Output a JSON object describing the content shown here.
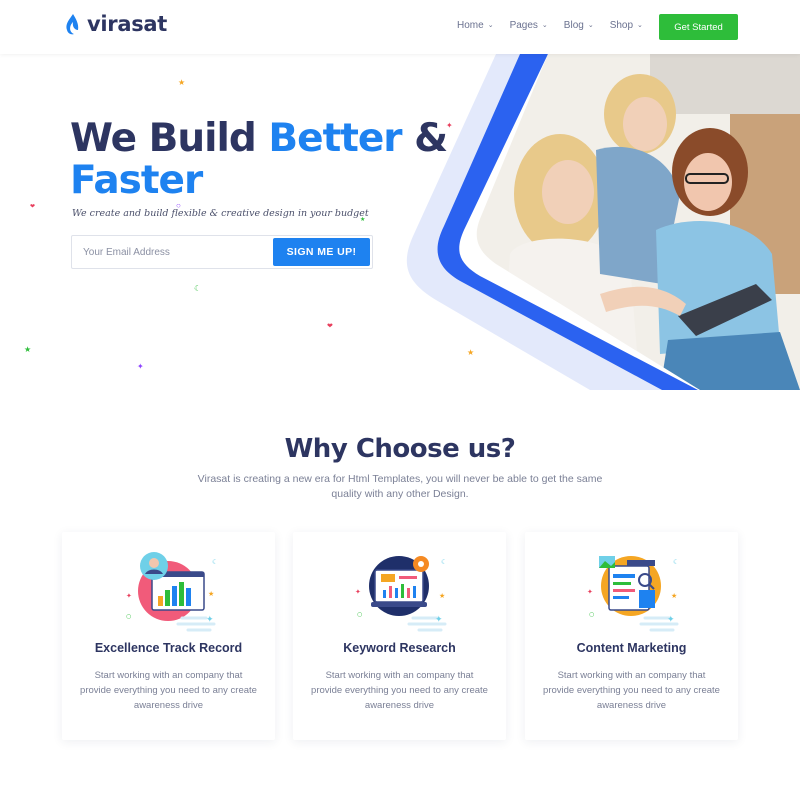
{
  "header": {
    "logo_text": "virasat",
    "nav": [
      {
        "label": "Home"
      },
      {
        "label": "Pages"
      },
      {
        "label": "Blog"
      },
      {
        "label": "Shop"
      }
    ],
    "cta_label": "Get Started"
  },
  "hero": {
    "headline_part1": "We Build ",
    "headline_highlight1": "Better",
    "headline_part2": " &",
    "headline_highlight2": "Faster",
    "tagline": "We create and build flexible & creative design in your budget",
    "email_placeholder": "Your Email Address",
    "signup_label": "SIGN ME UP!"
  },
  "why": {
    "title": "Why Choose us?",
    "subtitle": "Virasat is creating a new era for Html Templates, you will never be able to get the same quality with any other Design.",
    "cards": [
      {
        "title": "Excellence Track Record",
        "text": "Start working with an company that provide everything you need to any create awareness drive",
        "icon": "track-record-icon"
      },
      {
        "title": "Keyword Research",
        "text": "Start working with an company that provide everything you need to any create awareness drive",
        "icon": "keyword-research-icon"
      },
      {
        "title": "Content Marketing",
        "text": "Start working with an company that provide everything you need to any create awareness drive",
        "icon": "content-marketing-icon"
      }
    ]
  },
  "colors": {
    "brand_blue": "#1e82f0",
    "navy": "#2d3561",
    "cta_green": "#2ebd3a",
    "text_gray": "#7b8096"
  }
}
